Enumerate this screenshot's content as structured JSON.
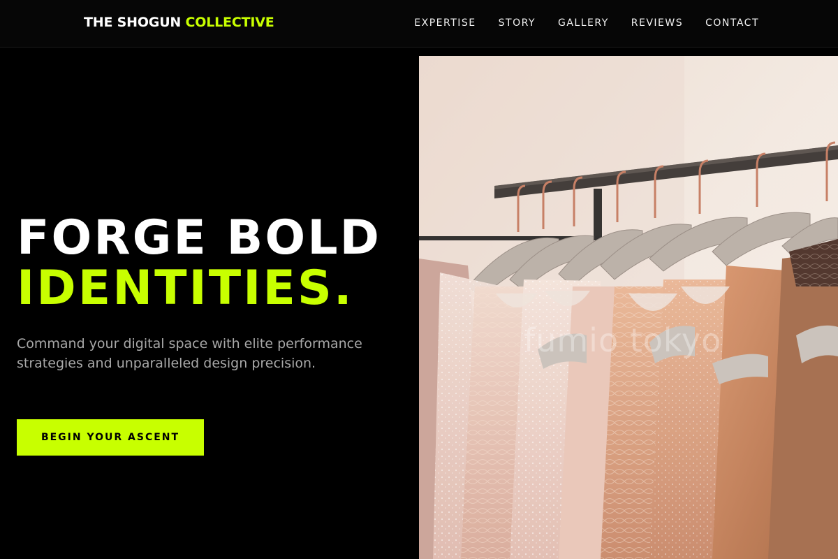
{
  "brand": {
    "name_part1": "THE SHOGUN",
    "name_part2": "COLLECTIVE",
    "accent_color": "#c8ff00"
  },
  "nav": {
    "items": [
      {
        "label": "EXPERTISE"
      },
      {
        "label": "STORY"
      },
      {
        "label": "GALLERY"
      },
      {
        "label": "REVIEWS"
      },
      {
        "label": "CONTACT"
      }
    ]
  },
  "hero": {
    "title_line1": "FORGE BOLD",
    "title_line2": "IDENTITIES.",
    "subtitle": "Command your digital space with elite performance strategies and unparalleled design precision.",
    "cta_label": "BEGIN YOUR ASCENT",
    "image": {
      "subject": "clothing-rack-with-dresses-on-hangers",
      "watermark": "fumio tokyo"
    }
  }
}
